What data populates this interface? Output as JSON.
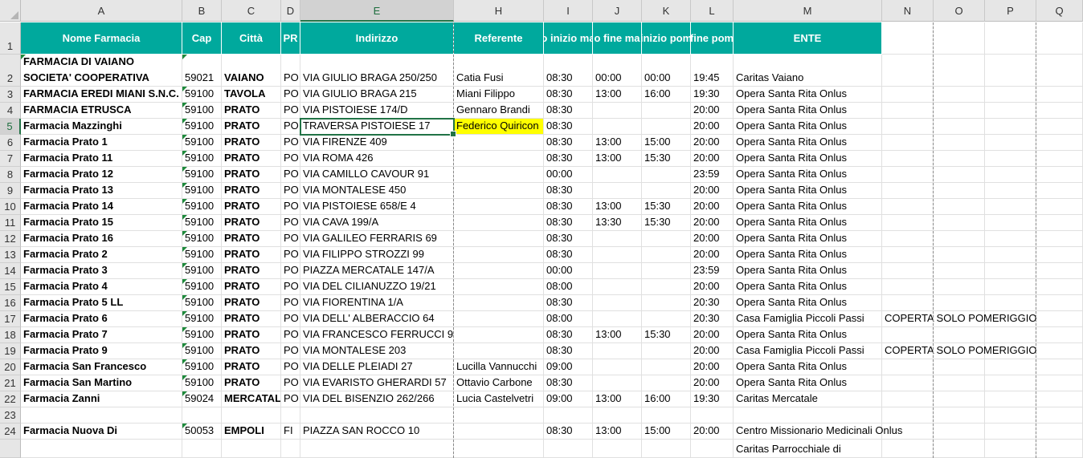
{
  "columns": [
    "A",
    "B",
    "C",
    "D",
    "E",
    "H",
    "I",
    "J",
    "K",
    "L",
    "M",
    "N",
    "O",
    "P",
    "Q"
  ],
  "selected_column": "E",
  "selected_row": "5",
  "header_row": {
    "row_number": "1",
    "labels": [
      "Nome Farmacia",
      "Cap",
      "Città",
      "PR",
      "Indirizzo",
      "Referente",
      "o inizio ma",
      "o fine ma",
      "inizio pom",
      "fine pom",
      "ENTE"
    ]
  },
  "rows": [
    {
      "num": "2",
      "a": [
        "FARMACIA DI VAIANO",
        "SOCIETA' COOPERATIVA"
      ],
      "b": "59021",
      "c": "VAIANO",
      "d": "PO",
      "e": "VIA GIULIO BRAGA 250/250",
      "h": "Catia Fusi",
      "i": "08:30",
      "j": "00:00",
      "k": "00:00",
      "l": "19:45",
      "m": "Caritas Vaiano",
      "n": ""
    },
    {
      "num": "3",
      "a": "FARMACIA EREDI MIANI S.N.C.",
      "b": "59100",
      "c": "TAVOLA",
      "d": "PO",
      "e": "VIA GIULIO BRAGA 215",
      "h": "Miani Filippo",
      "i": "08:30",
      "j": "13:00",
      "k": "16:00",
      "l": "19:30",
      "m": "Opera Santa Rita Onlus",
      "n": ""
    },
    {
      "num": "4",
      "a": "FARMACIA ETRUSCA",
      "b": "59100",
      "c": "PRATO",
      "d": "PO",
      "e": "VIA PISTOIESE 174/D",
      "h": "Gennaro Brandi",
      "i": "08:30",
      "j": "",
      "k": "",
      "l": "20:00",
      "m": "Opera Santa Rita Onlus",
      "n": ""
    },
    {
      "num": "5",
      "a": "Farmacia Mazzinghi",
      "b": "59100",
      "c": "PRATO",
      "d": "PO",
      "e": "TRAVERSA PISTOIESE 17",
      "h": "Federico Quiricon",
      "i": "08:30",
      "j": "",
      "k": "",
      "l": "20:00",
      "m": "Opera Santa Rita Onlus",
      "n": ""
    },
    {
      "num": "6",
      "a": "Farmacia Prato 1",
      "b": "59100",
      "c": "PRATO",
      "d": "PO",
      "e": "VIA FIRENZE 409",
      "h": "",
      "i": "08:30",
      "j": "13:00",
      "k": "15:00",
      "l": "20:00",
      "m": "Opera Santa Rita Onlus",
      "n": ""
    },
    {
      "num": "7",
      "a": "Farmacia Prato 11",
      "b": "59100",
      "c": "PRATO",
      "d": "PO",
      "e": "VIA ROMA 426",
      "h": "",
      "i": "08:30",
      "j": "13:00",
      "k": "15:30",
      "l": "20:00",
      "m": "Opera Santa Rita Onlus",
      "n": ""
    },
    {
      "num": "8",
      "a": "Farmacia Prato 12",
      "b": "59100",
      "c": "PRATO",
      "d": "PO",
      "e": "VIA CAMILLO CAVOUR 91",
      "h": "",
      "i": "00:00",
      "j": "",
      "k": "",
      "l": "23:59",
      "m": "Opera Santa Rita Onlus",
      "n": ""
    },
    {
      "num": "9",
      "a": "Farmacia Prato 13",
      "b": "59100",
      "c": "PRATO",
      "d": "PO",
      "e": "VIA MONTALESE 450",
      "h": "",
      "i": "08:30",
      "j": "",
      "k": "",
      "l": "20:00",
      "m": "Opera Santa Rita Onlus",
      "n": ""
    },
    {
      "num": "10",
      "a": "Farmacia Prato 14",
      "b": "59100",
      "c": "PRATO",
      "d": "PO",
      "e": "VIA PISTOIESE 658/E 4",
      "h": "",
      "i": "08:30",
      "j": "13:00",
      "k": "15:30",
      "l": "20:00",
      "m": "Opera Santa Rita Onlus",
      "n": ""
    },
    {
      "num": "11",
      "a": "Farmacia Prato 15",
      "b": "59100",
      "c": "PRATO",
      "d": "PO",
      "e": "VIA CAVA 199/A",
      "h": "",
      "i": "08:30",
      "j": "13:30",
      "k": "15:30",
      "l": "20:00",
      "m": "Opera Santa Rita Onlus",
      "n": ""
    },
    {
      "num": "12",
      "a": "Farmacia Prato 16",
      "b": "59100",
      "c": "PRATO",
      "d": "PO",
      "e": "VIA GALILEO FERRARIS 69",
      "h": "",
      "i": "08:30",
      "j": "",
      "k": "",
      "l": "20:00",
      "m": "Opera Santa Rita Onlus",
      "n": ""
    },
    {
      "num": "13",
      "a": "Farmacia Prato 2",
      "b": "59100",
      "c": "PRATO",
      "d": "PO",
      "e": "VIA FILIPPO STROZZI 99",
      "h": "",
      "i": "08:30",
      "j": "",
      "k": "",
      "l": "20:00",
      "m": "Opera Santa Rita Onlus",
      "n": ""
    },
    {
      "num": "14",
      "a": "Farmacia Prato 3",
      "b": "59100",
      "c": "PRATO",
      "d": "PO",
      "e": "PIAZZA MERCATALE 147/A",
      "h": "",
      "i": "00:00",
      "j": "",
      "k": "",
      "l": "23:59",
      "m": "Opera Santa Rita Onlus",
      "n": ""
    },
    {
      "num": "15",
      "a": "Farmacia Prato 4",
      "b": "59100",
      "c": "PRATO",
      "d": "PO",
      "e": "VIA DEL CILIANUZZO 19/21",
      "h": "",
      "i": "08:00",
      "j": "",
      "k": "",
      "l": "20:00",
      "m": "Opera Santa Rita Onlus",
      "n": ""
    },
    {
      "num": "16",
      "a": "Farmacia Prato 5 LL",
      "b": "59100",
      "c": "PRATO",
      "d": "PO",
      "e": "VIA FIORENTINA 1/A",
      "h": "",
      "i": "08:30",
      "j": "",
      "k": "",
      "l": "20:30",
      "m": "Opera Santa Rita Onlus",
      "n": ""
    },
    {
      "num": "17",
      "a": "Farmacia Prato 6",
      "b": "59100",
      "c": "PRATO",
      "d": "PO",
      "e": "VIA DELL' ALBERACCIO 64",
      "h": "",
      "i": "08:00",
      "j": "",
      "k": "",
      "l": "20:30",
      "m": "Casa Famiglia Piccoli Passi",
      "n": "COPERTA SOLO POMERIGGIO"
    },
    {
      "num": "18",
      "a": "Farmacia Prato 7",
      "b": "59100",
      "c": "PRATO",
      "d": "PO",
      "e": "VIA FRANCESCO FERRUCCI 95/F",
      "h": "",
      "i": "08:30",
      "j": "13:00",
      "k": "15:30",
      "l": "20:00",
      "m": "Opera Santa Rita Onlus",
      "n": ""
    },
    {
      "num": "19",
      "a": "Farmacia Prato 9",
      "b": "59100",
      "c": "PRATO",
      "d": "PO",
      "e": "VIA MONTALESE 203",
      "h": "",
      "i": "08:30",
      "j": "",
      "k": "",
      "l": "20:00",
      "m": "Casa Famiglia Piccoli Passi",
      "n": "COPERTA SOLO POMERIGGIO"
    },
    {
      "num": "20",
      "a": "Farmacia San Francesco",
      "b": "59100",
      "c": "PRATO",
      "d": "PO",
      "e": "VIA DELLE PLEIADI 27",
      "h": "Lucilla Vannucchi",
      "i": "09:00",
      "j": "",
      "k": "",
      "l": "20:00",
      "m": "Opera Santa Rita Onlus",
      "n": ""
    },
    {
      "num": "21",
      "a": "Farmacia San Martino",
      "b": "59100",
      "c": "PRATO",
      "d": "PO",
      "e": "VIA EVARISTO GHERARDI 57",
      "h": "Ottavio Carbone",
      "i": "08:30",
      "j": "",
      "k": "",
      "l": "20:00",
      "m": "Opera Santa Rita Onlus",
      "n": ""
    },
    {
      "num": "22",
      "a": "Farmacia Zanni",
      "b": "59024",
      "c": "MERCATALE",
      "d": "PO",
      "e": "VIA DEL BISENZIO 262/266",
      "h": "Lucia Castelvetri",
      "i": "09:00",
      "j": "13:00",
      "k": "16:00",
      "l": "19:30",
      "m": "Caritas Mercatale",
      "n": ""
    },
    {
      "num": "23",
      "a": "",
      "b": "",
      "c": "",
      "d": "",
      "e": "",
      "h": "",
      "i": "",
      "j": "",
      "k": "",
      "l": "",
      "m": "",
      "n": ""
    },
    {
      "num": "24",
      "a": "Farmacia Nuova Di",
      "b": "50053",
      "c": "EMPOLI",
      "d": "FI",
      "e": "PIAZZA SAN ROCCO 10",
      "h": "",
      "i": "08:30",
      "j": "13:00",
      "k": "15:00",
      "l": "20:00",
      "m": "Centro Missionario Medicinali Onlus",
      "n": ""
    },
    {
      "num": "",
      "a": "",
      "b": "",
      "c": "",
      "d": "",
      "e": "",
      "h": "",
      "i": "",
      "j": "",
      "k": "",
      "l": "",
      "m": " Caritas Parrocchiale di",
      "n": ""
    }
  ]
}
